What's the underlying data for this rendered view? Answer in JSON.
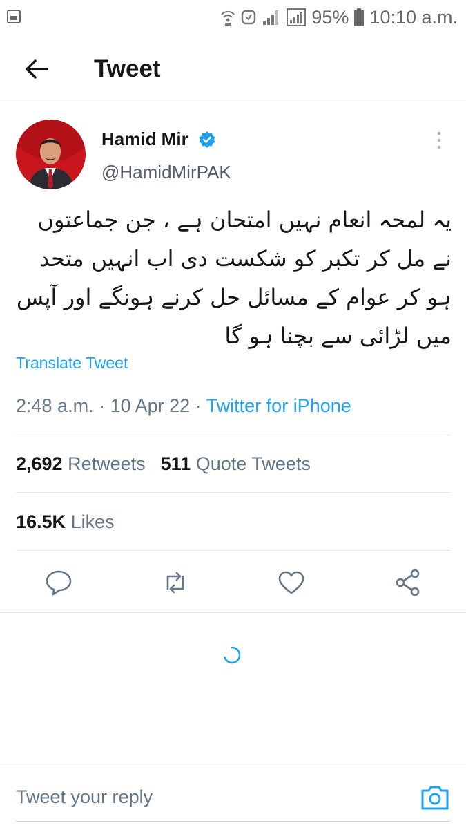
{
  "status_bar": {
    "battery": "95%",
    "time": "10:10 a.m."
  },
  "header": {
    "title": "Tweet"
  },
  "tweet": {
    "author_name": "Hamid Mir",
    "author_handle": "@HamidMirPAK",
    "text": "یہ لمحہ انعام نہیں امتحان ہے ، جن جماعتوں نے مل کر تکبر کو شکست دی اب انہیں متحد ہو کر عوام کے مسائل حل کرنے ہونگے اور آپس میں لڑائی سے بچنا ہو گا",
    "translate_label": "Translate Tweet",
    "time": "2:48 a.m.",
    "date": "10 Apr 22",
    "source": "Twitter for iPhone",
    "separator": " · "
  },
  "stats": {
    "retweets_count": "2,692",
    "retweets_label": "Retweets",
    "quotes_count": "511",
    "quotes_label": "Quote Tweets",
    "likes_count": "16.5K",
    "likes_label": "Likes"
  },
  "reply": {
    "placeholder": "Tweet your reply"
  },
  "colors": {
    "accent": "#1da1f2",
    "text": "#14171a",
    "secondary": "#657786",
    "divider": "#e1e8ed"
  },
  "icons": {
    "back": "arrow-left-icon",
    "verified": "verified-badge-icon",
    "more": "more-vertical-icon",
    "reply": "comment-icon",
    "retweet": "retweet-icon",
    "like": "heart-icon",
    "share": "share-icon",
    "camera": "camera-icon"
  }
}
